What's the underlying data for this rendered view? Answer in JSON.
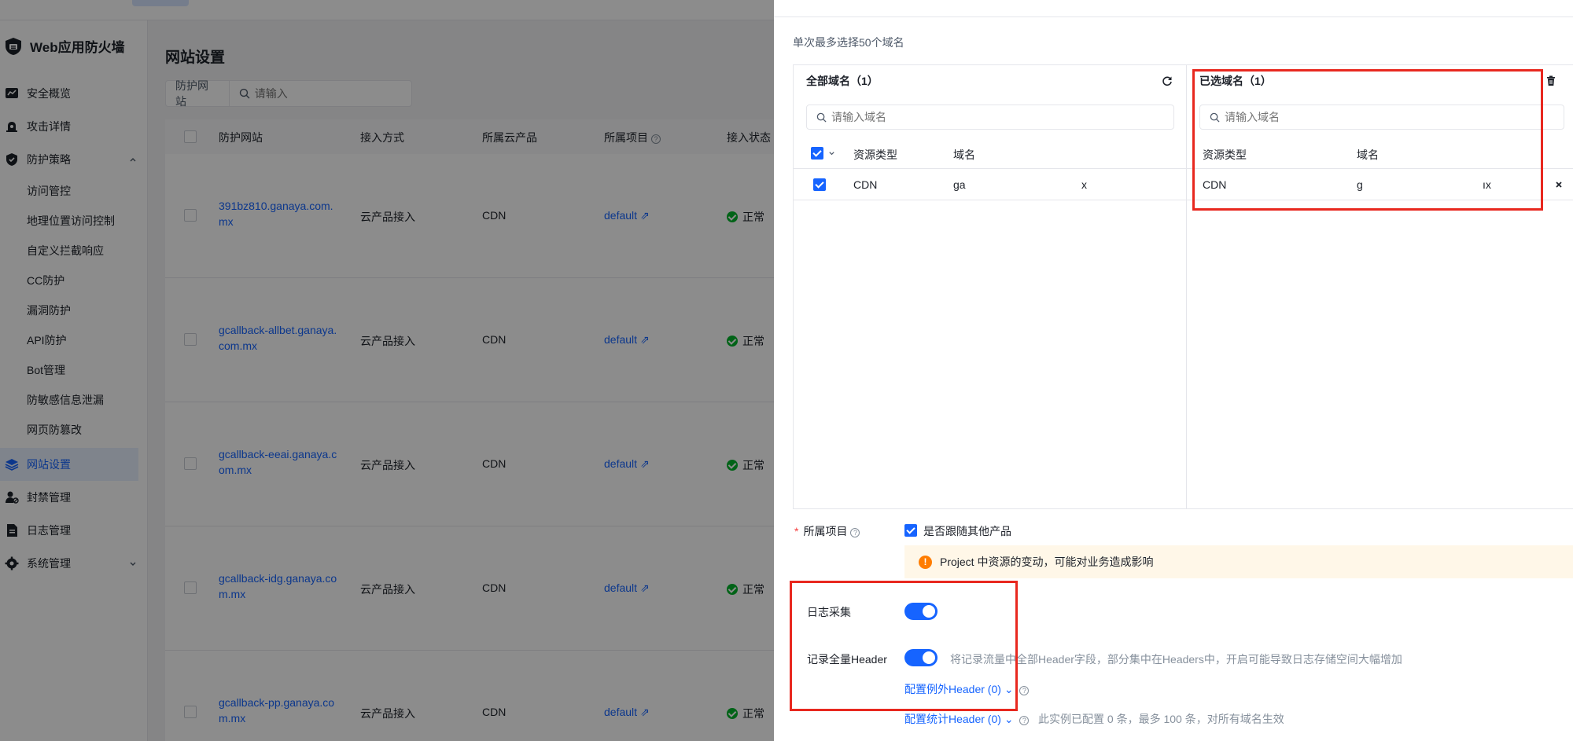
{
  "topbar": {
    "text": ""
  },
  "sidebar": {
    "brand": "Web应用防火墙",
    "items": [
      {
        "label": "安全概览"
      },
      {
        "label": "攻击详情"
      },
      {
        "label": "防护策略"
      },
      {
        "label": "网站设置"
      },
      {
        "label": "封禁管理"
      },
      {
        "label": "日志管理"
      },
      {
        "label": "系统管理"
      }
    ],
    "sub_items": [
      {
        "label": "访问管控"
      },
      {
        "label": "地理位置访问控制"
      },
      {
        "label": "自定义拦截响应"
      },
      {
        "label": "CC防护"
      },
      {
        "label": "漏洞防护"
      },
      {
        "label": "API防护"
      },
      {
        "label": "Bot管理"
      },
      {
        "label": "防敏感信息泄漏"
      },
      {
        "label": "网页防篡改"
      }
    ]
  },
  "main": {
    "title": "网站设置",
    "filter": {
      "label": "防护网站",
      "placeholder": "请输入"
    },
    "columns": [
      "防护网站",
      "接入方式",
      "所属云产品",
      "所属项目",
      "接入状态"
    ],
    "rows": [
      {
        "site_line1": "391bz810.ganaya.com.",
        "site_line2": "mx",
        "access": "云产品接入",
        "product": "CDN",
        "project": "default",
        "status": "正常"
      },
      {
        "site_line1": "gcallback-allbet.ganaya.",
        "site_line2": "com.mx",
        "access": "云产品接入",
        "product": "CDN",
        "project": "default",
        "status": "正常"
      },
      {
        "site_line1": "gcallback-eeai.ganaya.c",
        "site_line2": "om.mx",
        "access": "云产品接入",
        "product": "CDN",
        "project": "default",
        "status": "正常"
      },
      {
        "site_line1": "gcallback-idg.ganaya.co",
        "site_line2": "m.mx",
        "access": "云产品接入",
        "product": "CDN",
        "project": "default",
        "status": "正常"
      },
      {
        "site_line1": "gcallback-pp.ganaya.co",
        "site_line2": "m.mx",
        "access": "云产品接入",
        "product": "CDN",
        "project": "default",
        "status": "正常"
      }
    ]
  },
  "drawer": {
    "hint": "单次最多选择50个域名",
    "left_panel": {
      "title": "全部域名（1）",
      "search_placeholder": "请输入域名",
      "col_type": "资源类型",
      "col_domain": "域名",
      "row": {
        "type": "CDN",
        "domain_a": "ga",
        "domain_b": "x"
      }
    },
    "right_panel": {
      "title": "已选域名（1）",
      "search_placeholder": "请输入域名",
      "col_type": "资源类型",
      "col_domain": "域名",
      "row": {
        "type": "CDN",
        "domain_a": "g",
        "domain_b": "ıx"
      }
    },
    "project": {
      "label": "所属项目",
      "follow_label": "是否跟随其他产品",
      "alert": "Project 中资源的变动，可能对业务造成影响"
    },
    "log_collect": {
      "label": "日志采集",
      "enabled": true
    },
    "full_header": {
      "label": "记录全量Header",
      "enabled": true,
      "desc": "将记录流量中全部Header字段，部分集中在Headers中，开启可能导致日志存储空间大幅增加"
    },
    "exclude_header": {
      "label": "配置例外Header (0)"
    },
    "stat_header": {
      "label": "配置统计Header (0)",
      "desc": "此实例已配置 0 条，最多 100 条，对所有域名生效"
    }
  },
  "colors": {
    "accent": "#1664ff",
    "highlight": "#e8281f",
    "success": "#00b42a",
    "warning": "#ff7d00"
  }
}
